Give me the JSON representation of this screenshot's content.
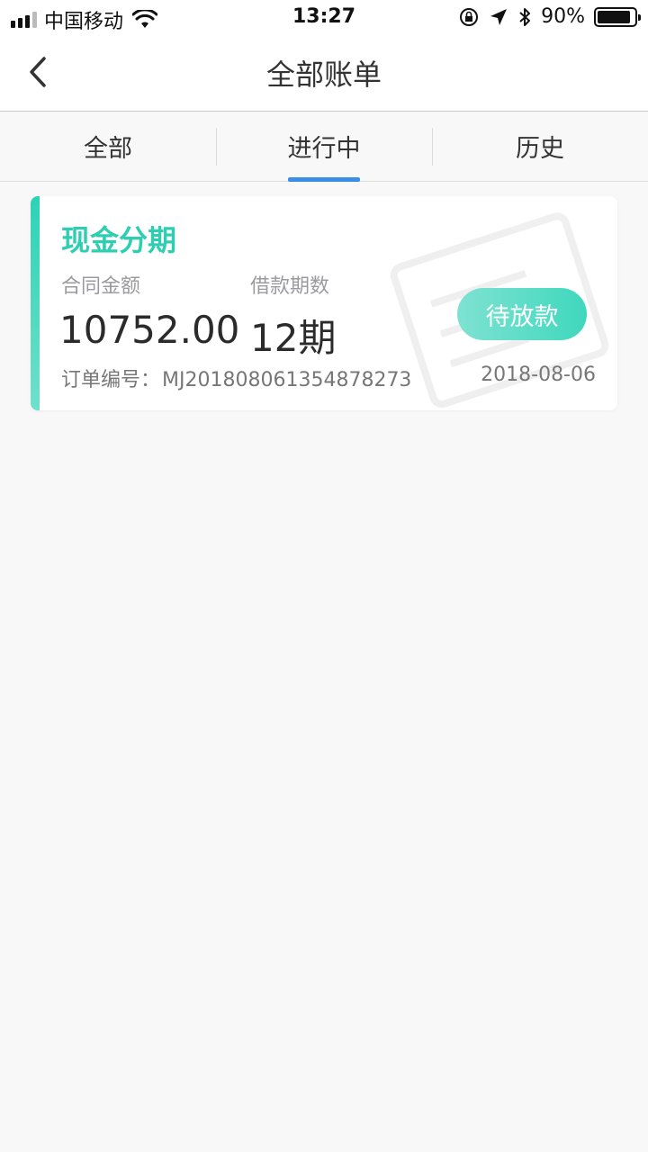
{
  "status_bar": {
    "carrier": "中国移动",
    "time": "13:27",
    "battery": "90%"
  },
  "nav": {
    "title": "全部账单"
  },
  "tabs": [
    {
      "label": "全部",
      "active": false
    },
    {
      "label": "进行中",
      "active": true
    },
    {
      "label": "历史",
      "active": false
    }
  ],
  "colors": {
    "accent_green": "#2ecfb1",
    "tab_indicator": "#3a8ee6"
  },
  "bill": {
    "title": "现金分期",
    "amount_label": "合同金额",
    "amount": "10752.00",
    "term_label": "借款期数",
    "term": "12期",
    "status": "待放款",
    "order_label": "订单编号：",
    "order_no": "MJ20180806135487827​3",
    "date": "2018-08-06"
  }
}
